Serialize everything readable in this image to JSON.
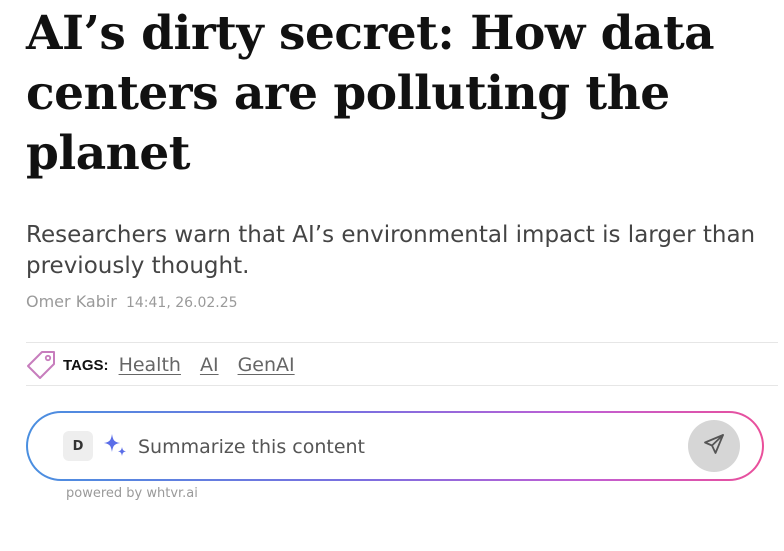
{
  "article": {
    "headline": "AI’s dirty secret: How data centers are polluting the planet",
    "subtitle": "Researchers warn that AI’s environmental impact is larger than previously thought.",
    "author": "Omer Kabir",
    "timestamp": "14:41, 26.02.25"
  },
  "tags": {
    "label": "TAGS:",
    "icon": "tag-icon",
    "items": [
      {
        "label": "Health"
      },
      {
        "label": "AI"
      },
      {
        "label": "GenAI"
      }
    ]
  },
  "summarize": {
    "avatar_letter": "D",
    "placeholder": "Summarize this content",
    "sparkle_icon": "sparkle-icon",
    "send_icon": "send-icon",
    "powered_by": "powered by whtvr.ai"
  },
  "colors": {
    "headline": "#111111",
    "subtitle": "#444444",
    "muted": "#9a9a9a",
    "tag_icon": "#c77dbd",
    "gradient_start": "#4a8fe0",
    "gradient_end": "#ea4f9a",
    "send_button_bg": "#d6d6d6"
  }
}
